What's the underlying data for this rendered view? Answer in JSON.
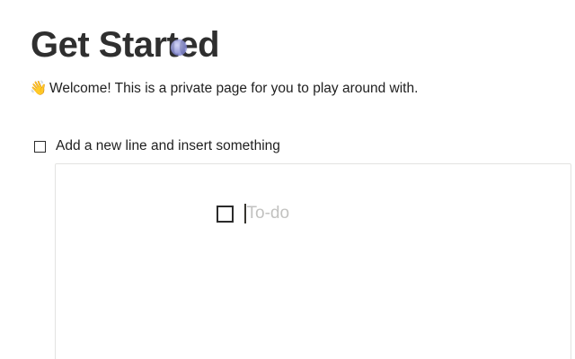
{
  "page": {
    "title": "Get Started",
    "welcome_icon": "waving-hand-icon",
    "welcome_emoji": "👋",
    "welcome_text": "Welcome! This is a private page for you to play around with.",
    "todo": {
      "label": "Add a new line and insert something",
      "checked": false
    },
    "embed": {
      "todo_placeholder": "To-do",
      "checked": false
    }
  },
  "colors": {
    "text": "#2f2f2f",
    "placeholder": "#c2c2c0",
    "border": "#e3e3e1",
    "pointer": "#8a8fd6"
  }
}
